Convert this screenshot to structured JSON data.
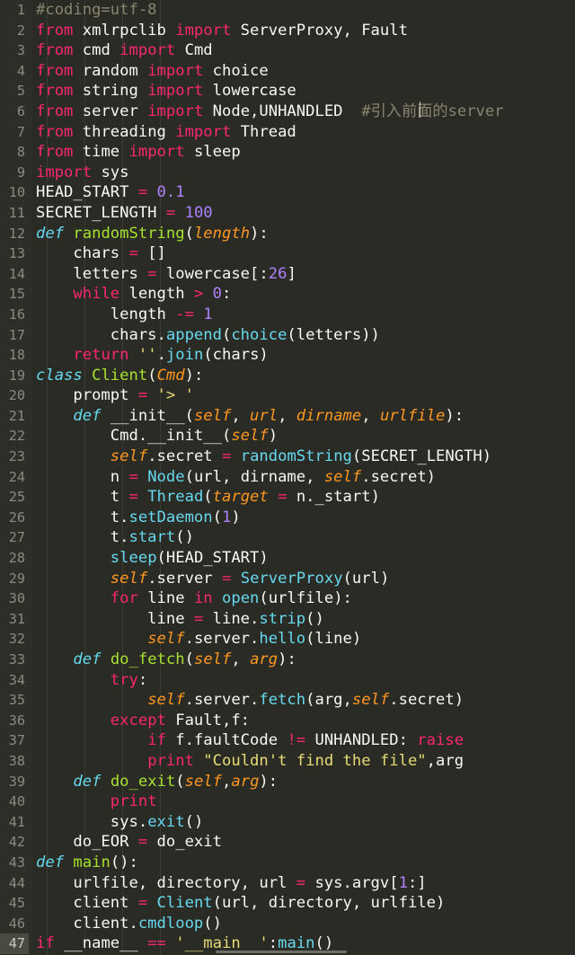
{
  "editor": {
    "language": "Python",
    "theme": "Monokai",
    "background": "#2b2b26",
    "gutter_background": "#2e2e28",
    "active_line_number": 47,
    "total_lines": 47,
    "line_numbers": [
      1,
      2,
      3,
      4,
      5,
      6,
      7,
      8,
      9,
      10,
      11,
      12,
      13,
      14,
      15,
      16,
      17,
      18,
      19,
      20,
      21,
      22,
      23,
      24,
      25,
      26,
      27,
      28,
      29,
      30,
      31,
      32,
      33,
      34,
      35,
      36,
      37,
      38,
      39,
      40,
      41,
      42,
      43,
      44,
      45,
      46,
      47
    ],
    "colors": {
      "foreground": "#f8f8f2",
      "keyword": "#f92672",
      "definition": "#66d9ef",
      "function_name": "#a6e22e",
      "parameter": "#fd971f",
      "number": "#ae81ff",
      "string": "#e6db74",
      "comment": "#88846f",
      "line_number": "#8a8a80",
      "active_line_gutter": "#4a4a42"
    },
    "source_lines": [
      "#coding=utf-8",
      "from xmlrpclib import ServerProxy, Fault",
      "from cmd import Cmd",
      "from random import choice",
      "from string import lowercase",
      "from server import Node,UNHANDLED  #引入前面的server",
      "from threading import Thread",
      "from time import sleep",
      "import sys",
      "HEAD_START = 0.1",
      "SECRET_LENGTH = 100",
      "def randomString(length):",
      "    chars = []",
      "    letters = lowercase[:26]",
      "    while length > 0:",
      "        length -= 1",
      "        chars.append(choice(letters))",
      "    return ''.join(chars)",
      "class Client(Cmd):",
      "    prompt = '> '",
      "    def __init__(self, url, dirname, urlfile):",
      "        Cmd.__init__(self)",
      "        self.secret = randomString(SECRET_LENGTH)",
      "        n = Node(url, dirname, self.secret)",
      "        t = Thread(target = n._start)",
      "        t.setDaemon(1)",
      "        t.start()",
      "        sleep(HEAD_START)",
      "        self.server = ServerProxy(url)",
      "        for line in open(urlfile):",
      "            line = line.strip()",
      "            self.server.hello(line)",
      "    def do_fetch(self, arg):",
      "        try:",
      "            self.server.fetch(arg,self.secret)",
      "        except Fault,f:",
      "            if f.faultCode != UNHANDLED: raise",
      "            print \"Couldn't find the file\",arg",
      "    def do_exit(self,arg):",
      "        print",
      "        sys.exit()",
      "    do_EOR = do_exit",
      "def main():",
      "    urlfile, directory, url = sys.argv[1:]",
      "    client = Client(url, directory, urlfile)",
      "    client.cmdloop()",
      "if __name__ == '__main__':main()"
    ]
  }
}
